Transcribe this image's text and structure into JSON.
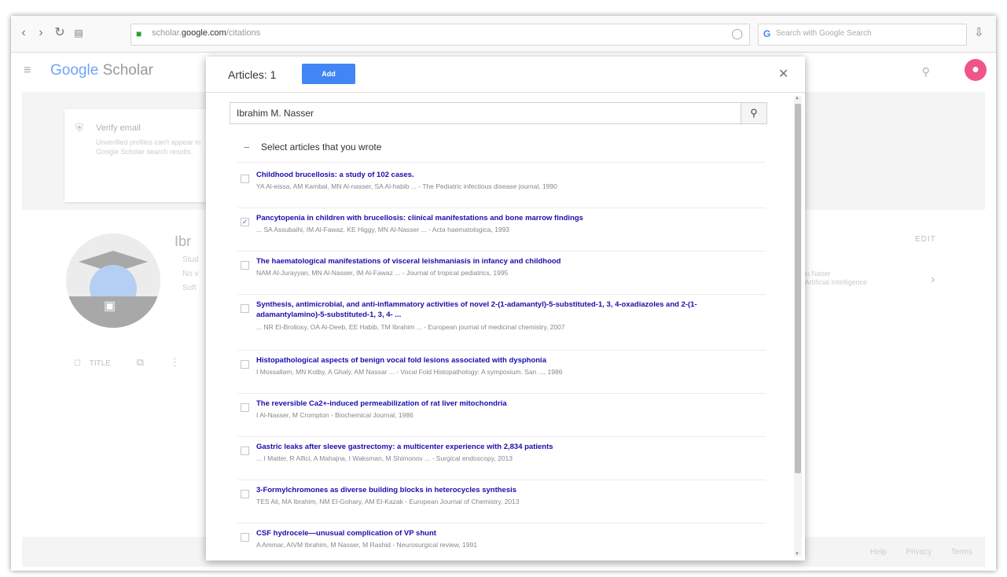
{
  "browser": {
    "url_prefix": "scholar.",
    "url_domain": "google.com",
    "url_path": "/citations",
    "search_placeholder": "Search with Google Search"
  },
  "header": {
    "logo_google": "Google",
    "logo_scholar": "Scholar",
    "avatar_letter": ""
  },
  "background": {
    "verify_title": "Verify email",
    "verify_desc": "Unverified profiles can't appear in Google Scholar search results.",
    "profile_name": "Ibr",
    "profile_lines": [
      "Stud",
      "No v",
      "Soft"
    ],
    "edit_label": "EDIT",
    "coauthor_name": "Abu Naser",
    "coauthor_affil": "of Artificial Intelligence",
    "toolbar_title": "TITLE",
    "footer_links": "Help Privacy Terms"
  },
  "modal": {
    "title": "Articles: 1",
    "add_label": "Add",
    "search_value": "Ibrahim M. Nasser",
    "select_all_label": "Select articles that you wrote",
    "articles": [
      {
        "title": "Childhood brucellosis: a study of 102 cases.",
        "meta": "YA Al-eissa, AM Kambal, MN Al-nasser, SA Al-habib ... - The Pediatric infectious disease journal, 1990",
        "checked": false
      },
      {
        "title": "Pancytopenia in children with brucellosis: clinical manifestations and bone marrow findings",
        "meta": "... SA Assubaihi, IM Al-Fawaz, KE Higgy, MN Al-Nasser ... - Acta haematologica, 1993",
        "checked": true
      },
      {
        "title": "The haematological manifestations of visceral leishmaniasis in infancy and childhood",
        "meta": "NAM Al-Jurayyan, MN Al-Nasser, IM Al-Fawaz ... - Journal of tropical pediatrics, 1995",
        "checked": false
      },
      {
        "title": "Synthesis, antimicrobial, and anti-inflammatory activities of novel 2-(1-adamantyl)-5-substituted-1, 3, 4-oxadiazoles and 2-(1-adamantylamino)-5-substituted-1, 3, 4- ...",
        "meta": "... NR El-Brollosy, OA Al-Deeb, EE Habib, TM Ibrahim ... - European journal of medicinal chemistry, 2007",
        "checked": false
      },
      {
        "title": "Histopathological aspects of benign vocal fold lesions associated with dysphonia",
        "meta": "I Mossallam, MN Kotby, A Ghaly, AM Nassar ... - Vocal Fold Histopathology: A symposium. San ..., 1986",
        "checked": false
      },
      {
        "title": "The reversible Ca2+-induced permeabilization of rat liver mitochondria",
        "meta": "I Al-Nasser, M Crompton - Biochemical Journal, 1986",
        "checked": false
      },
      {
        "title": "Gastric leaks after sleeve gastrectomy: a multicenter experience with 2,834 patients",
        "meta": "... I Matter, R Alfici, A Mahajna, I Waksman, M Shimonov ... - Surgical endoscopy, 2013",
        "checked": false
      },
      {
        "title": "3-Formylchromones as diverse building blocks in heterocycles synthesis",
        "meta": "TES Ali, MA Ibrahim, NM El-Gohary, AM El-Kazak - European Journal of Chemistry, 2013",
        "checked": false
      },
      {
        "title": "CSF hydrocele—unusual complication of VP shunt",
        "meta": "A Ammar, AIVM Ibrahim, M Nasser, M Rashid - Neurosurgical review, 1991",
        "checked": false
      }
    ]
  }
}
